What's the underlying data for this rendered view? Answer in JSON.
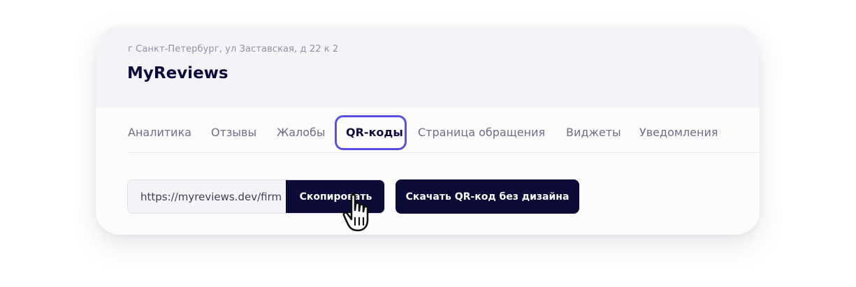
{
  "header": {
    "address": "г Санкт-Петербург, ул Заставская, д 22 к 2",
    "title": "MyReviews"
  },
  "tabs": [
    {
      "label": "Аналитика",
      "active": false
    },
    {
      "label": "Отзывы",
      "active": false
    },
    {
      "label": "Жалобы",
      "active": false
    },
    {
      "label": "QR-коды",
      "active": true
    },
    {
      "label": "Страница обращения",
      "active": false
    },
    {
      "label": "Виджеты",
      "active": false
    },
    {
      "label": "Уведомления",
      "active": false
    }
  ],
  "link": {
    "value": "https://myreviews.dev/firm",
    "copy_label": "Скопировать"
  },
  "download_label": "Скачать QR-код без дизайна",
  "cursor_icon": "hand-pointer-icon",
  "colors": {
    "accent_dark": "#0c0a36",
    "highlight": "#5a4fe0",
    "header_bg": "#f4f4f8",
    "muted_text": "#6d6d85"
  }
}
